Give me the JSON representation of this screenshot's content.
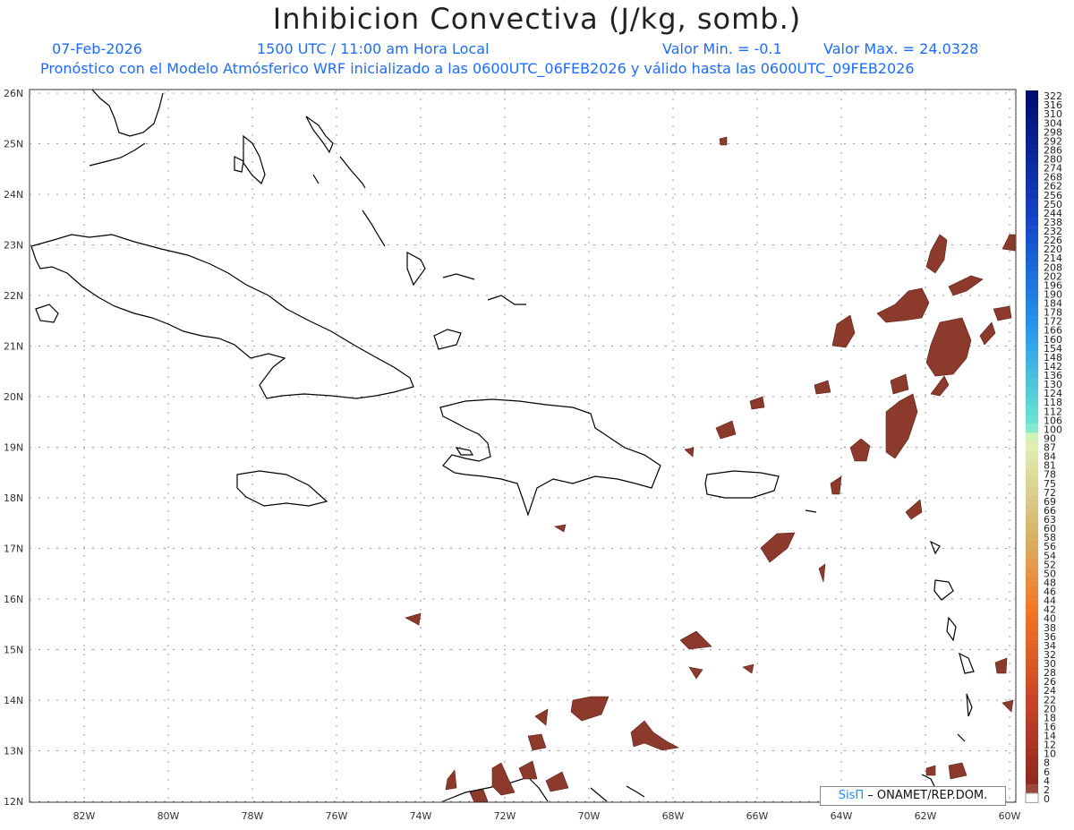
{
  "header": {
    "title": "Inhibicion Convectiva (J/kg, somb.)",
    "date": "07-Feb-2026",
    "time": "1500 UTC / 11:00 am Hora Local",
    "value_min": "Valor Min. = -0.1",
    "value_max": "Valor Max. = 24.0328",
    "description": "Pronóstico con el Modelo Atmósferico WRF inicializado a las 0600UTC_06FEB2026 y válido hasta las  0600UTC_09FEB2026"
  },
  "axes": {
    "lat_labels": [
      "26N",
      "25N",
      "24N",
      "23N",
      "22N",
      "21N",
      "20N",
      "19N",
      "18N",
      "17N",
      "16N",
      "15N",
      "14N",
      "13N",
      "12N"
    ],
    "lon_labels": [
      "82W",
      "80W",
      "78W",
      "76W",
      "74W",
      "72W",
      "70W",
      "68W",
      "66W",
      "64W",
      "62W",
      "60W"
    ]
  },
  "colorbar": {
    "labels": [
      "322",
      "316",
      "310",
      "304",
      "298",
      "292",
      "286",
      "280",
      "274",
      "268",
      "262",
      "256",
      "250",
      "244",
      "238",
      "232",
      "226",
      "220",
      "214",
      "208",
      "202",
      "196",
      "190",
      "184",
      "178",
      "172",
      "166",
      "160",
      "154",
      "148",
      "142",
      "136",
      "130",
      "124",
      "118",
      "112",
      "106",
      "100",
      "90",
      "87",
      "84",
      "81",
      "78",
      "75",
      "72",
      "69",
      "66",
      "63",
      "60",
      "58",
      "56",
      "54",
      "52",
      "50",
      "48",
      "46",
      "44",
      "42",
      "40",
      "38",
      "36",
      "34",
      "32",
      "30",
      "28",
      "26",
      "24",
      "22",
      "20",
      "18",
      "16",
      "14",
      "12",
      "10",
      "8",
      "6",
      "4",
      "2",
      "0"
    ]
  },
  "credit": {
    "brand": "SisΠ",
    "text": "– ONAMET/REP.DOM."
  },
  "colors": {
    "title": "#222222",
    "subtitle": "#1e6cff",
    "shading": "#8b3a2b",
    "coast": "#000000",
    "grid": "#9a9a9a"
  }
}
